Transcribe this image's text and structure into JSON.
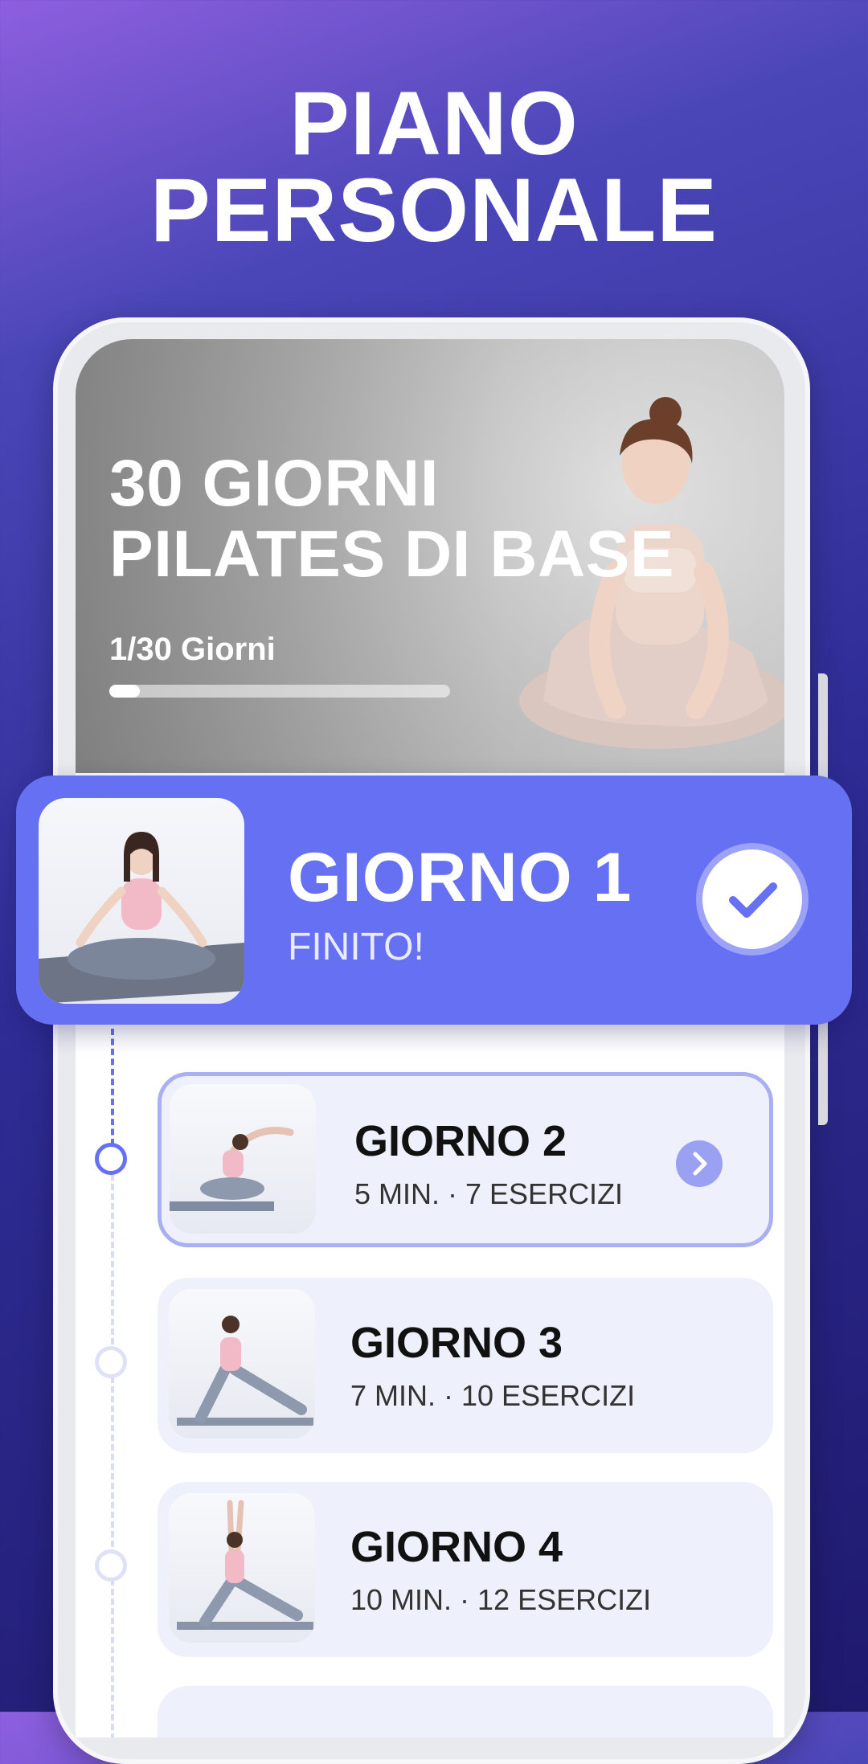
{
  "headline": {
    "line1": "PIANO",
    "line2": "PERSONALE"
  },
  "plan": {
    "title_line1": "30 GIORNI",
    "title_line2": "PILATES DI BASE",
    "progress_label": "1/30 Giorni",
    "progress_fraction": 0.033
  },
  "current_day": {
    "title": "GIORNO 1",
    "status": "FINITO!"
  },
  "days": [
    {
      "title": "GIORNO 2",
      "meta": "5 MIN. · 7 ESERCIZI"
    },
    {
      "title": "GIORNO 3",
      "meta": "7 MIN. · 10 ESERCIZI"
    },
    {
      "title": "GIORNO 4",
      "meta": "10 MIN. · 12 ESERCIZI"
    }
  ],
  "colors": {
    "accent": "#6670f3",
    "card": "#eef0fb",
    "background_top": "#8e5fe0",
    "background_bottom": "#1f1a6e"
  },
  "icons": {
    "done": "check-icon",
    "next": "chevron-right-icon"
  }
}
